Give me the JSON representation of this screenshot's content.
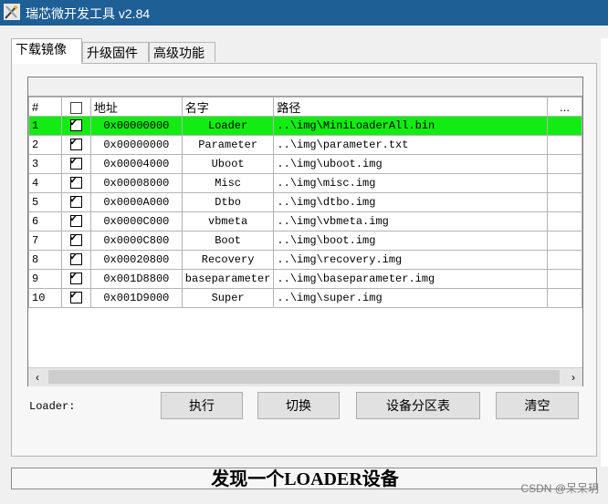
{
  "window": {
    "title": "瑞芯微开发工具 v2.84"
  },
  "tabs": [
    {
      "label": "下载镜像",
      "active": true
    },
    {
      "label": "升级固件",
      "active": false
    },
    {
      "label": "高级功能",
      "active": false
    }
  ],
  "table": {
    "headers": [
      "#",
      "",
      "地址",
      "名字",
      "路径",
      "..."
    ],
    "rows": [
      {
        "index": "1",
        "checked": true,
        "address": "0x00000000",
        "name": "Loader",
        "path": "..\\img\\MiniLoaderAll.bin",
        "selected": true
      },
      {
        "index": "2",
        "checked": true,
        "address": "0x00000000",
        "name": "Parameter",
        "path": "..\\img\\parameter.txt",
        "selected": false
      },
      {
        "index": "3",
        "checked": true,
        "address": "0x00004000",
        "name": "Uboot",
        "path": "..\\img\\uboot.img",
        "selected": false
      },
      {
        "index": "4",
        "checked": true,
        "address": "0x00008000",
        "name": "Misc",
        "path": "..\\img\\misc.img",
        "selected": false
      },
      {
        "index": "5",
        "checked": true,
        "address": "0x0000A000",
        "name": "Dtbo",
        "path": "..\\img\\dtbo.img",
        "selected": false
      },
      {
        "index": "6",
        "checked": true,
        "address": "0x0000C000",
        "name": "vbmeta",
        "path": "..\\img\\vbmeta.img",
        "selected": false
      },
      {
        "index": "7",
        "checked": true,
        "address": "0x0000C800",
        "name": "Boot",
        "path": "..\\img\\boot.img",
        "selected": false
      },
      {
        "index": "8",
        "checked": true,
        "address": "0x00020800",
        "name": "Recovery",
        "path": "..\\img\\recovery.img",
        "selected": false
      },
      {
        "index": "9",
        "checked": true,
        "address": "0x001D8800",
        "name": "baseparameter",
        "path": "..\\img\\baseparameter.img",
        "selected": false
      },
      {
        "index": "10",
        "checked": true,
        "address": "0x001D9000",
        "name": "Super",
        "path": "..\\img\\super.img",
        "selected": false
      }
    ]
  },
  "scrollbar": {
    "left_arrow": "‹",
    "right_arrow": "›"
  },
  "loader_label": "Loader:",
  "buttons": {
    "run": "执行",
    "switch": "切换",
    "partition_table": "设备分区表",
    "clear": "清空"
  },
  "status": {
    "text": "发现一个LOADER设备"
  },
  "watermark": "CSDN @呆呆玥",
  "colors": {
    "titlebar": "#1e5f96",
    "selected_row": "#12ec12"
  }
}
